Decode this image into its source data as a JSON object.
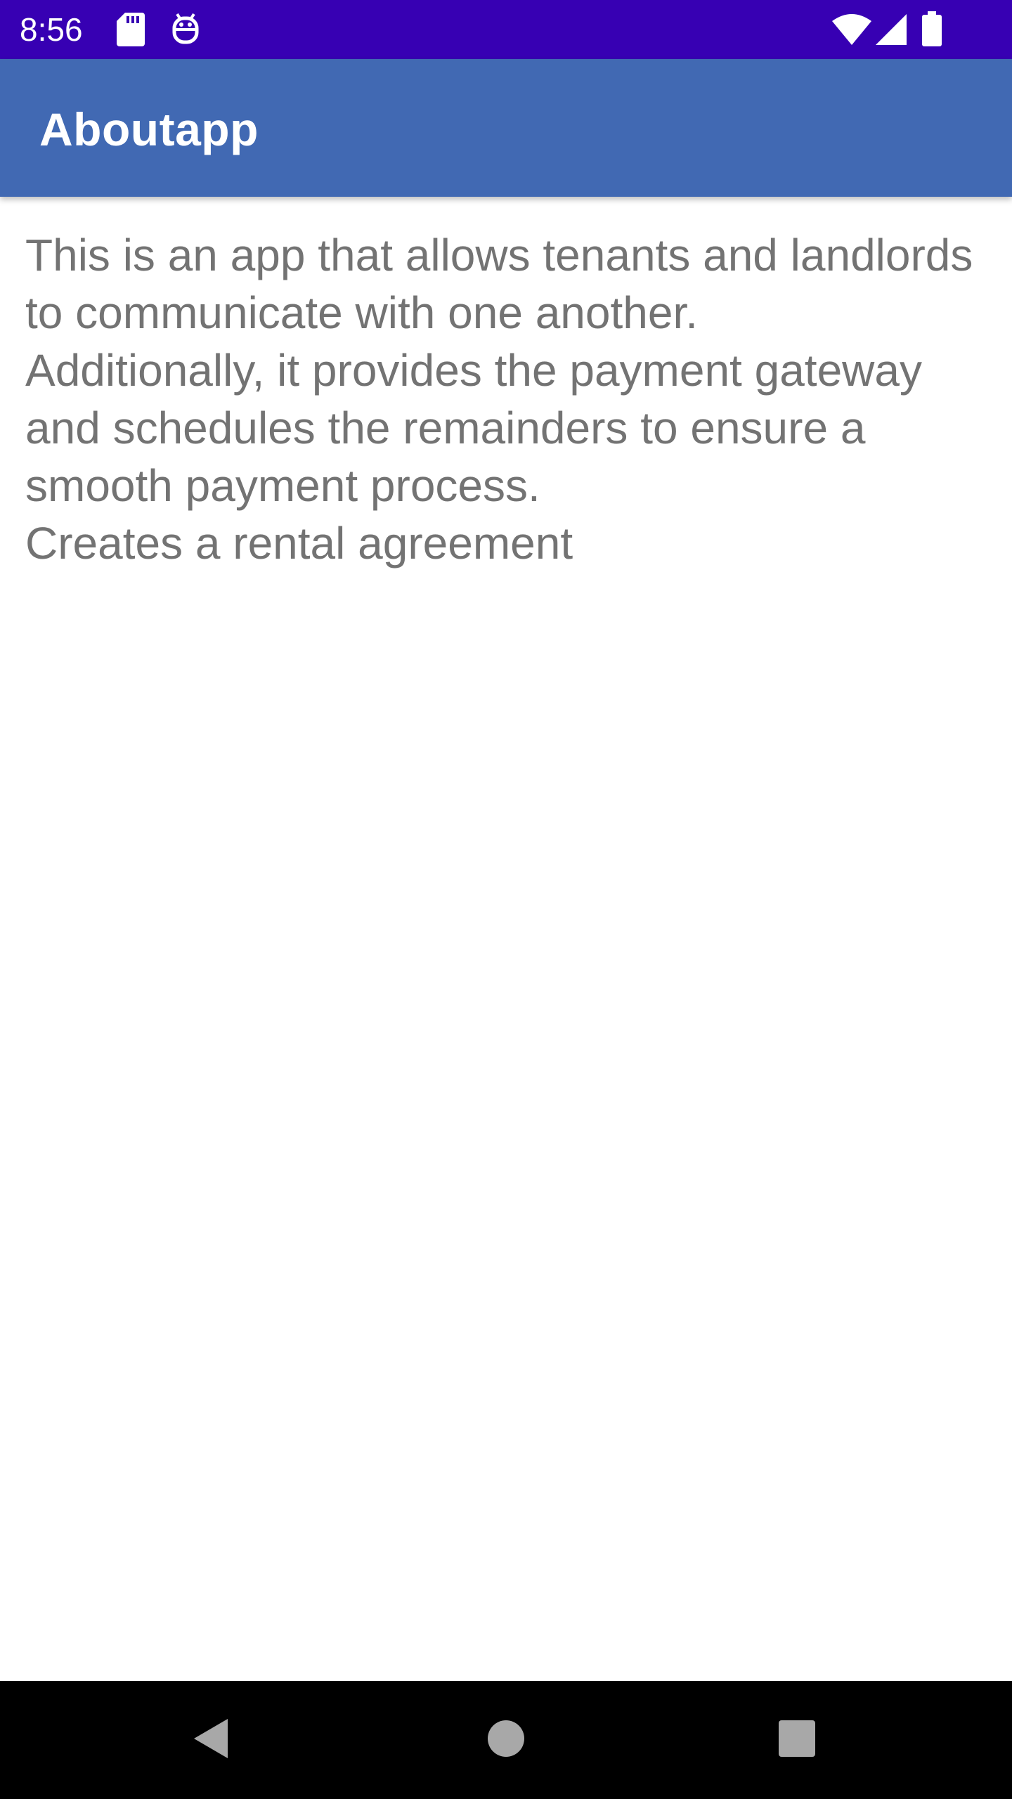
{
  "status_bar": {
    "time": "8:56",
    "icons": [
      "sd-card-icon",
      "notification-robot-icon",
      "wifi-icon",
      "cellular-signal-icon",
      "battery-icon"
    ]
  },
  "app_bar": {
    "title": "Aboutapp"
  },
  "content": {
    "description": " This is an app that allows tenants and landlords to communicate with one another.\n  Additionally, it provides the payment gateway and schedules the remainders to ensure a smooth payment process.\n Creates a rental agreement"
  },
  "nav_bar": {
    "buttons": [
      "back-icon",
      "home-icon",
      "recents-icon"
    ]
  },
  "colors": {
    "status_bar": "#3700b3",
    "app_bar": "#4169b3",
    "body_text": "#737373",
    "nav_bar": "#000000"
  }
}
